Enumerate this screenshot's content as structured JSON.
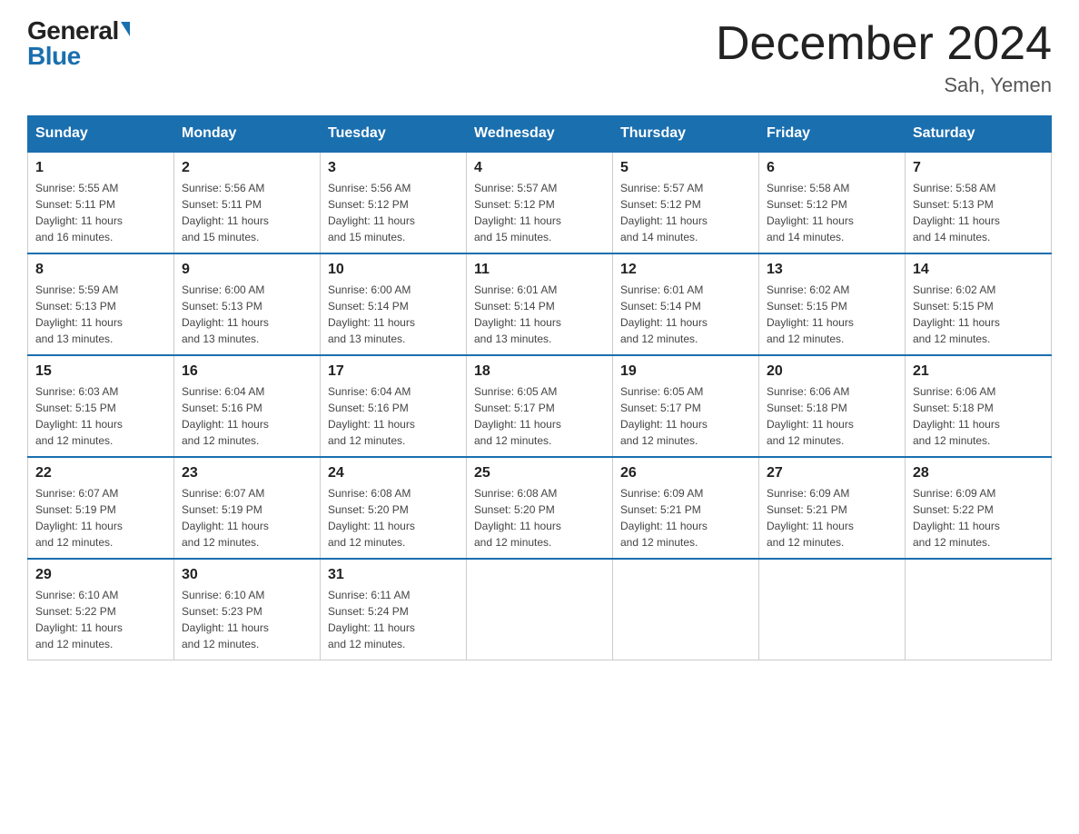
{
  "header": {
    "logo_general": "General",
    "logo_blue": "Blue",
    "title": "December 2024",
    "subtitle": "Sah, Yemen"
  },
  "days_of_week": [
    "Sunday",
    "Monday",
    "Tuesday",
    "Wednesday",
    "Thursday",
    "Friday",
    "Saturday"
  ],
  "weeks": [
    [
      {
        "day": "1",
        "sunrise": "5:55 AM",
        "sunset": "5:11 PM",
        "daylight": "11 hours and 16 minutes."
      },
      {
        "day": "2",
        "sunrise": "5:56 AM",
        "sunset": "5:11 PM",
        "daylight": "11 hours and 15 minutes."
      },
      {
        "day": "3",
        "sunrise": "5:56 AM",
        "sunset": "5:12 PM",
        "daylight": "11 hours and 15 minutes."
      },
      {
        "day": "4",
        "sunrise": "5:57 AM",
        "sunset": "5:12 PM",
        "daylight": "11 hours and 15 minutes."
      },
      {
        "day": "5",
        "sunrise": "5:57 AM",
        "sunset": "5:12 PM",
        "daylight": "11 hours and 14 minutes."
      },
      {
        "day": "6",
        "sunrise": "5:58 AM",
        "sunset": "5:12 PM",
        "daylight": "11 hours and 14 minutes."
      },
      {
        "day": "7",
        "sunrise": "5:58 AM",
        "sunset": "5:13 PM",
        "daylight": "11 hours and 14 minutes."
      }
    ],
    [
      {
        "day": "8",
        "sunrise": "5:59 AM",
        "sunset": "5:13 PM",
        "daylight": "11 hours and 13 minutes."
      },
      {
        "day": "9",
        "sunrise": "6:00 AM",
        "sunset": "5:13 PM",
        "daylight": "11 hours and 13 minutes."
      },
      {
        "day": "10",
        "sunrise": "6:00 AM",
        "sunset": "5:14 PM",
        "daylight": "11 hours and 13 minutes."
      },
      {
        "day": "11",
        "sunrise": "6:01 AM",
        "sunset": "5:14 PM",
        "daylight": "11 hours and 13 minutes."
      },
      {
        "day": "12",
        "sunrise": "6:01 AM",
        "sunset": "5:14 PM",
        "daylight": "11 hours and 12 minutes."
      },
      {
        "day": "13",
        "sunrise": "6:02 AM",
        "sunset": "5:15 PM",
        "daylight": "11 hours and 12 minutes."
      },
      {
        "day": "14",
        "sunrise": "6:02 AM",
        "sunset": "5:15 PM",
        "daylight": "11 hours and 12 minutes."
      }
    ],
    [
      {
        "day": "15",
        "sunrise": "6:03 AM",
        "sunset": "5:15 PM",
        "daylight": "11 hours and 12 minutes."
      },
      {
        "day": "16",
        "sunrise": "6:04 AM",
        "sunset": "5:16 PM",
        "daylight": "11 hours and 12 minutes."
      },
      {
        "day": "17",
        "sunrise": "6:04 AM",
        "sunset": "5:16 PM",
        "daylight": "11 hours and 12 minutes."
      },
      {
        "day": "18",
        "sunrise": "6:05 AM",
        "sunset": "5:17 PM",
        "daylight": "11 hours and 12 minutes."
      },
      {
        "day": "19",
        "sunrise": "6:05 AM",
        "sunset": "5:17 PM",
        "daylight": "11 hours and 12 minutes."
      },
      {
        "day": "20",
        "sunrise": "6:06 AM",
        "sunset": "5:18 PM",
        "daylight": "11 hours and 12 minutes."
      },
      {
        "day": "21",
        "sunrise": "6:06 AM",
        "sunset": "5:18 PM",
        "daylight": "11 hours and 12 minutes."
      }
    ],
    [
      {
        "day": "22",
        "sunrise": "6:07 AM",
        "sunset": "5:19 PM",
        "daylight": "11 hours and 12 minutes."
      },
      {
        "day": "23",
        "sunrise": "6:07 AM",
        "sunset": "5:19 PM",
        "daylight": "11 hours and 12 minutes."
      },
      {
        "day": "24",
        "sunrise": "6:08 AM",
        "sunset": "5:20 PM",
        "daylight": "11 hours and 12 minutes."
      },
      {
        "day": "25",
        "sunrise": "6:08 AM",
        "sunset": "5:20 PM",
        "daylight": "11 hours and 12 minutes."
      },
      {
        "day": "26",
        "sunrise": "6:09 AM",
        "sunset": "5:21 PM",
        "daylight": "11 hours and 12 minutes."
      },
      {
        "day": "27",
        "sunrise": "6:09 AM",
        "sunset": "5:21 PM",
        "daylight": "11 hours and 12 minutes."
      },
      {
        "day": "28",
        "sunrise": "6:09 AM",
        "sunset": "5:22 PM",
        "daylight": "11 hours and 12 minutes."
      }
    ],
    [
      {
        "day": "29",
        "sunrise": "6:10 AM",
        "sunset": "5:22 PM",
        "daylight": "11 hours and 12 minutes."
      },
      {
        "day": "30",
        "sunrise": "6:10 AM",
        "sunset": "5:23 PM",
        "daylight": "11 hours and 12 minutes."
      },
      {
        "day": "31",
        "sunrise": "6:11 AM",
        "sunset": "5:24 PM",
        "daylight": "11 hours and 12 minutes."
      },
      null,
      null,
      null,
      null
    ]
  ]
}
